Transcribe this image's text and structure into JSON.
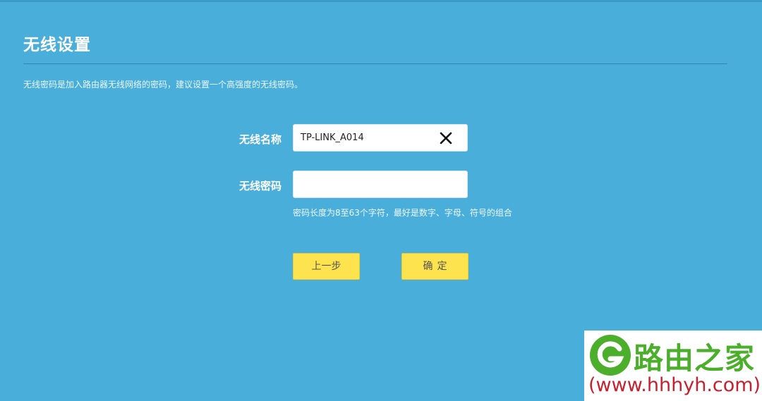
{
  "page": {
    "title": "无线设置",
    "description": "无线密码是加入路由器无线网络的密码，建议设置一个高强度的无线密码。"
  },
  "form": {
    "ssid_label": "无线名称",
    "ssid_value": "TP-LINK_A014",
    "password_label": "无线密码",
    "password_value": "",
    "password_hint": "密码长度为8至63个字符，最好是数字、字母、符号的组合"
  },
  "buttons": {
    "back_label": "上一步",
    "confirm_label": "确定"
  },
  "icons": {
    "clear": "close-icon"
  },
  "watermark": {
    "name": "路由之家",
    "url": "(www.hhhyh.com)"
  },
  "colors": {
    "background": "#4aaedb",
    "button": "#fde34d",
    "watermark_green": "#4caf2c",
    "watermark_red": "#c8202f"
  }
}
